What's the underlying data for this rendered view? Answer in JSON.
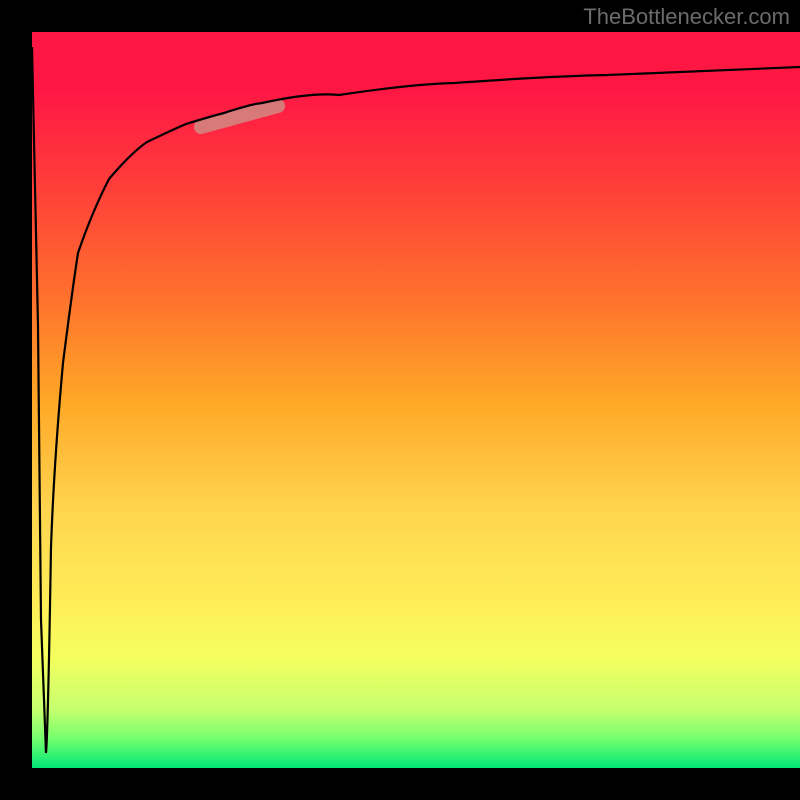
{
  "watermark": "TheBottlenecker.com",
  "chart_data": {
    "type": "line",
    "title": "",
    "xlabel": "",
    "ylabel": "",
    "xlim": [
      0,
      100
    ],
    "ylim": [
      0,
      100
    ],
    "series": [
      {
        "name": "bottleneck-curve",
        "x": [
          0,
          0.8,
          1.2,
          1.8,
          2.5,
          4,
          6,
          10,
          15,
          20,
          25,
          30,
          40,
          55,
          75,
          100
        ],
        "values": [
          98,
          60,
          20,
          2,
          30,
          55,
          70,
          80,
          85,
          87.5,
          89,
          90,
          91.5,
          93,
          94.2,
          95.2
        ]
      }
    ],
    "annotations": [
      {
        "name": "highlight-segment",
        "x_range": [
          22,
          32
        ],
        "y_range": [
          87,
          90
        ],
        "color": "#d08a82"
      }
    ],
    "gradient_stops": [
      {
        "pos": 0,
        "color": "#ff1744"
      },
      {
        "pos": 8,
        "color": "#ff1744"
      },
      {
        "pos": 20,
        "color": "#ff3b3b"
      },
      {
        "pos": 35,
        "color": "#ff6d2e"
      },
      {
        "pos": 50,
        "color": "#ffa726"
      },
      {
        "pos": 65,
        "color": "#ffd54f"
      },
      {
        "pos": 78,
        "color": "#ffee58"
      },
      {
        "pos": 85,
        "color": "#f4ff5e"
      },
      {
        "pos": 92,
        "color": "#c6ff6e"
      },
      {
        "pos": 96,
        "color": "#76ff6e"
      },
      {
        "pos": 100,
        "color": "#00e676"
      }
    ]
  }
}
